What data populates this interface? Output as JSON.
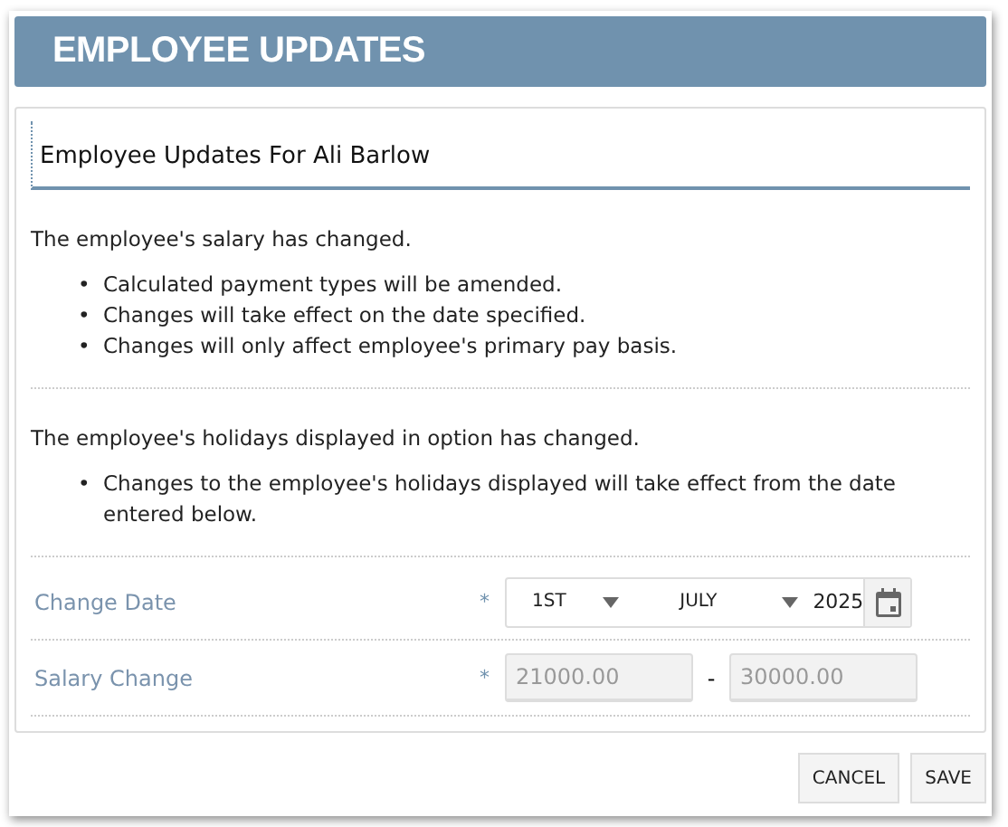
{
  "dialog": {
    "title": "EMPLOYEE UPDATES"
  },
  "panel": {
    "heading": "Employee Updates For Ali Barlow",
    "sections": [
      {
        "intro": "The employee's salary has changed.",
        "marker": "•",
        "bullets": [
          "Calculated payment types will be amended.",
          "Changes will take effect on the date specified.",
          "Changes will only affect employee's primary pay basis."
        ]
      },
      {
        "intro": "The employee's holidays displayed in option has changed.",
        "marker": "•",
        "bullets": [
          "Changes to the employee's holidays displayed will take effect from the date entered below."
        ]
      }
    ],
    "fields": [
      {
        "kind": "date",
        "label": "Change Date",
        "required": "*",
        "day": "1ST",
        "month": "JULY",
        "year": "2025"
      },
      {
        "kind": "range",
        "label": "Salary Change",
        "required": "*",
        "from": "21000.00",
        "separator": "-",
        "to": "30000.00",
        "disabled": true
      }
    ]
  },
  "buttons": [
    "CANCEL",
    "SAVE"
  ]
}
